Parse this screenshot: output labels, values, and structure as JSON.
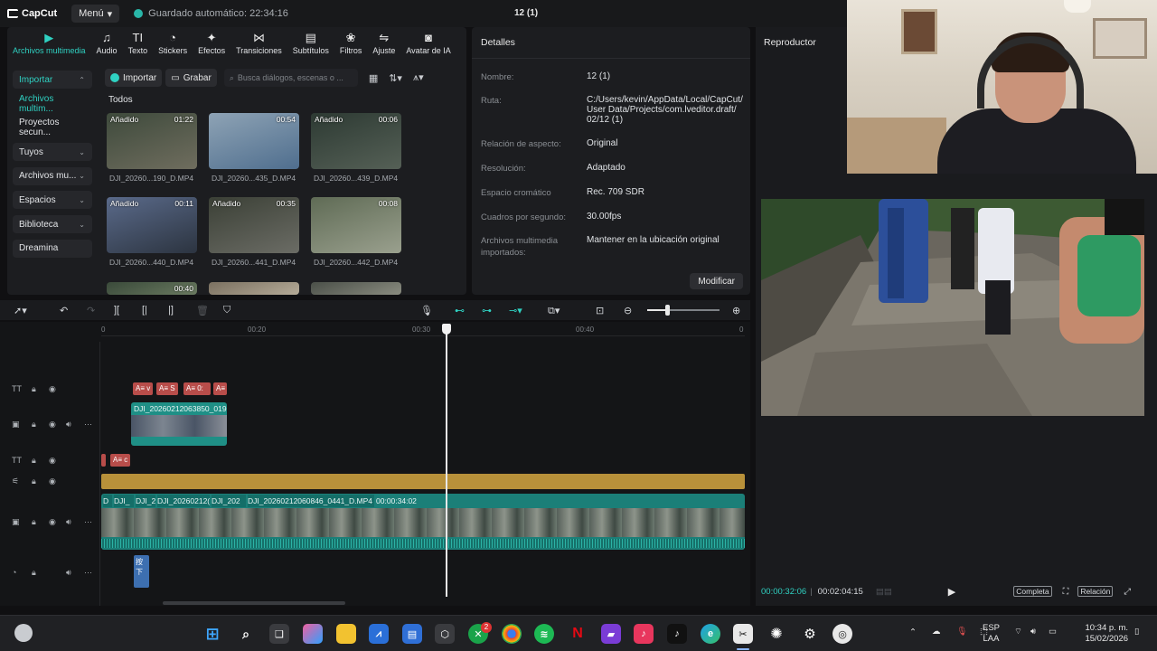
{
  "app": {
    "brand": "CapCut",
    "menu_label": "Menú",
    "autosave": "Guardado automático: 22:34:16",
    "project_title": "12 (1)"
  },
  "media_toolbar": [
    {
      "icon": "media-icon",
      "label": "Archivos multimedia",
      "active": true
    },
    {
      "icon": "audio-icon",
      "label": "Audio"
    },
    {
      "icon": "text-icon",
      "label": "Texto"
    },
    {
      "icon": "stickers-icon",
      "label": "Stickers"
    },
    {
      "icon": "effects-icon",
      "label": "Efectos"
    },
    {
      "icon": "transitions-icon",
      "label": "Transiciones"
    },
    {
      "icon": "subtitles-icon",
      "label": "Subtítulos"
    },
    {
      "icon": "filters-icon",
      "label": "Filtros"
    },
    {
      "icon": "adjust-icon",
      "label": "Ajuste"
    },
    {
      "icon": "ai-avatar-icon",
      "label": "Avatar de IA"
    }
  ],
  "sidebar": [
    {
      "label": "Importar",
      "chev": "up",
      "style": "accent"
    },
    {
      "label": "Archivos multim...",
      "style": "sel"
    },
    {
      "label": "Proyectos secun...",
      "style": "plain"
    },
    {
      "label": "Tuyos",
      "chev": "down",
      "style": "box"
    },
    {
      "label": "Archivos mu...",
      "chev": "down",
      "style": "box"
    },
    {
      "label": "Espacios",
      "chev": "down",
      "style": "box"
    },
    {
      "label": "Biblioteca",
      "chev": "down",
      "style": "box"
    },
    {
      "label": "Dreamina",
      "style": "box"
    }
  ],
  "media_top": {
    "import_label": "Importar",
    "record_label": "Grabar",
    "search_placeholder": "Busca diálogos, escenas o ..."
  },
  "media_filter": "Todos",
  "media_items": [
    {
      "name": "DJI_20260...190_D.MP4",
      "duration": "01:22",
      "badge": "Añadido",
      "colors": [
        "#3e4a3c",
        "#6f6d5e"
      ]
    },
    {
      "name": "DJI_20260...435_D.MP4",
      "duration": "00:54",
      "badge": "",
      "colors": [
        "#8ea3b5",
        "#4f6e8e"
      ]
    },
    {
      "name": "DJI_20260...439_D.MP4",
      "duration": "00:06",
      "badge": "Añadido",
      "colors": [
        "#2d3a33",
        "#556056"
      ]
    },
    {
      "name": "DJI_20260...440_D.MP4",
      "duration": "00:11",
      "badge": "Añadido",
      "colors": [
        "#5a6a8a",
        "#2c3440"
      ]
    },
    {
      "name": "DJI_20260...441_D.MP4",
      "duration": "00:35",
      "badge": "Añadido",
      "colors": [
        "#3b4036",
        "#6b6c65"
      ]
    },
    {
      "name": "DJI_20260...442_D.MP4",
      "duration": "00:08",
      "badge": "",
      "colors": [
        "#5f6b55",
        "#9aa08e"
      ]
    },
    {
      "name": "",
      "duration": "00:40",
      "badge": "",
      "colors": [
        "#3a4a3a",
        "#6a7a60"
      ]
    },
    {
      "name": "",
      "duration": "",
      "badge": "",
      "colors": [
        "#7a7060",
        "#b5ab98"
      ]
    },
    {
      "name": "",
      "duration": "",
      "badge": "",
      "colors": [
        "#4a4f48",
        "#8a8c80"
      ]
    }
  ],
  "details": {
    "title": "Detalles",
    "rows": [
      {
        "k": "Nombre:",
        "v": "12 (1)"
      },
      {
        "k": "Ruta:",
        "v": "C:/Users/kevin/AppData/Local/CapCut/ User Data/Projects/com.lveditor.draft/ 02/12 (1)"
      },
      {
        "k": "Relación de aspecto:",
        "v": "Original"
      },
      {
        "k": "Resolución:",
        "v": "Adaptado"
      },
      {
        "k": "Espacio cromático",
        "v": "Rec. 709 SDR"
      },
      {
        "k": "Cuadros por segundo:",
        "v": "30.00fps"
      },
      {
        "k": "Archivos multimedia importados:",
        "v": "Mantener en la ubicación original"
      }
    ],
    "modify_label": "Modificar"
  },
  "player": {
    "title": "Reproductor",
    "current_time": "00:00:32:06",
    "total_time": "00:02:04:15",
    "full_label": "Completa",
    "ratio_label": "Relación"
  },
  "timeline": {
    "ruler_labels": [
      "0",
      "00:20",
      "00:30",
      "00:40",
      "0"
    ],
    "text_clips": [
      "A≡ v",
      "A≡ S",
      "A≡ 0:",
      "A≡",
      "A≡ c"
    ],
    "overlay_clip_label": "DJI_20260212063850_019",
    "main_clip_labels": [
      "D",
      "DJI_",
      "DJI_2",
      "DJI_20260212(",
      "DJI_202",
      "DJI_20260212060846_0441_D.MP4",
      "00:00:34:02"
    ],
    "audio_clip_label": "按下"
  },
  "taskbar": {
    "lang_top": "ESP",
    "lang_bottom": "LAA",
    "time": "10:34 p. m.",
    "date": "15/02/2026",
    "xbox_badge": "2"
  },
  "colors": {
    "accent": "#2fd1c2",
    "text_clip": "#b84d4a",
    "video_clip": "#1f8f86",
    "filter_clip": "#b8913a"
  }
}
